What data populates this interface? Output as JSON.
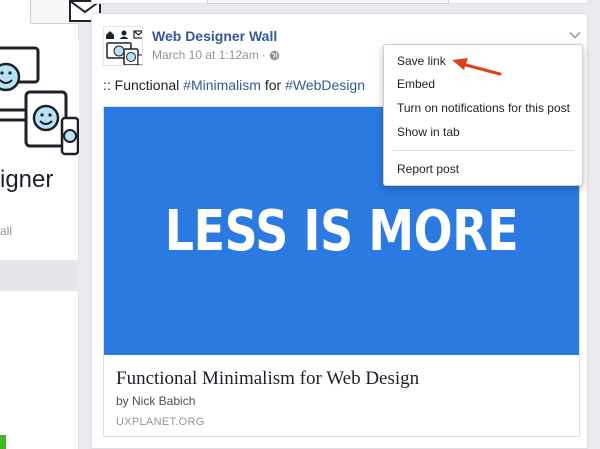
{
  "left_sidebar": {
    "name_fragment": "igner",
    "sub_fragment": "all"
  },
  "post": {
    "page_name": "Web Designer Wall",
    "timestamp": "March 10 at 1:12am",
    "meta_separator": "·",
    "text_prefix": ":: Functional ",
    "hashtag1": "#Minimalism",
    "text_middle": " for ",
    "hashtag2": "#WebDesign",
    "link": {
      "image_text": "LESS IS MORE",
      "title": "Functional Minimalism for Web Design",
      "author": "by Nick Babich",
      "domain": "UXPLANET.ORG"
    }
  },
  "menu": {
    "items": [
      "Save link",
      "Embed",
      "Turn on notifications for this post",
      "Show in tab",
      "Report post"
    ]
  },
  "colors": {
    "link_blue": "#365899",
    "image_blue": "#2a7ae2",
    "annotation_arrow": "#e0401a"
  },
  "icons": [
    "mail-icon",
    "globe-icon",
    "chevron-down-icon",
    "home-icon",
    "user-icon",
    "envelope-icon",
    "devices-illustration"
  ]
}
